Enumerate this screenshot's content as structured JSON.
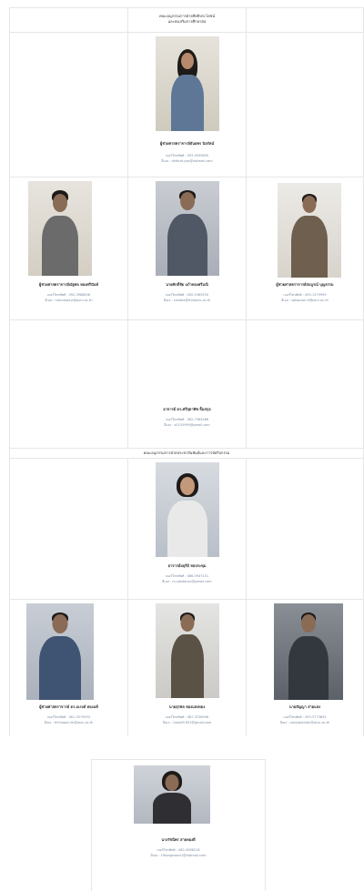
{
  "section1": {
    "title_line1": "คณะอนุกรรมการฝ่ายสิทธิประโยชน์",
    "title_line2": "และส่งเสริมการศึกษาต่อ"
  },
  "section2": {
    "title": "คณะอนุกรรมการฝ่ายประชาสัมพันธ์และการจัดกิจกรรม"
  },
  "people": [
    {
      "name": "ผู้ช่วยศาสตราจารย์ธันยพร นิลรัตน์",
      "phone": "เบอร์โทรศัพท์ : 093-5555800",
      "email": "อีเมล : dhitirat.yos@hotmail.com"
    },
    {
      "name": "ผู้ช่วยศาสตราจารย์ณัฐพล ทองศรีนันท์",
      "phone": "เบอร์โทรศัพท์ : 092-3988836",
      "email": "อีเมล : nannapat.p@psru.ac.th"
    },
    {
      "name": "นายศักดิ์ชัย แก้วทองศรีมณี",
      "phone": "เบอร์โทรศัพท์ : 092-5365530",
      "email": "อีเมล : sukdee@thaipsru.ac.th"
    },
    {
      "name": "ผู้ช่วยศาสตราจารย์สมบูรณ์ บุญธรรม",
      "phone": "เบอร์โทรศัพท์ : 093-1379999",
      "email": "อีเมล : sakapron.b@psru.ac.th"
    },
    {
      "name": "อาจารย์ ดร.ศรีสุดาทิพ ลิ้มสกุล",
      "phone": "เบอร์โทรศัพท์ : 062-7364586",
      "email": "อีเมล : s0153999@gmail.com"
    },
    {
      "name": "อาจารย์มยุรีย์ หอประทุม",
      "phone": "เบอร์โทรศัพท์ : 086-5947151",
      "email": "อีเมล : m.sakdanon@gmail.com"
    },
    {
      "name": "ผู้ช่วยศาสตราจารย์ ดร.ณรงค์ ทองแท้",
      "phone": "เบอร์โทรศัพท์ : 081-3579933",
      "email": "อีเมล : th9napon.th@psru.ac.th"
    },
    {
      "name": "นายสุรพล ทองแสงทอง",
      "phone": "เบอร์โทรศัพท์ : 087-3236096",
      "email": "อีเมล : 1sead9.001@gmail.com"
    },
    {
      "name": "นายสัญญา สายแสง",
      "phone": "เบอร์โทรศัพท์ : 093-3773855",
      "email": "อีเมล : sanyapenjan@psru.ac.th"
    },
    {
      "name": "นางรัชนีพร สายทองดี",
      "phone": "เบอร์โทรศัพท์ : 082-4588218",
      "email": "อีเมล : 19tongneam1@hotmail.com"
    }
  ],
  "colors": {
    "grid": "#e6e6e6",
    "link": "#7a8aa0",
    "text": "#333333"
  }
}
